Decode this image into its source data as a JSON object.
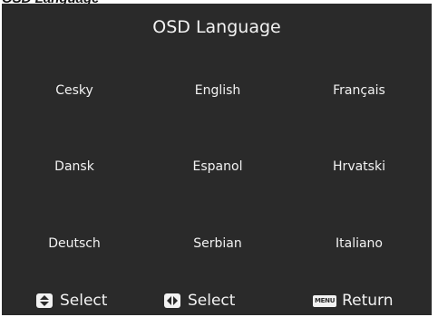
{
  "header_crop": "OSD Language",
  "osd": {
    "title": "OSD Language",
    "languages": [
      [
        "Cesky",
        "English",
        "Français"
      ],
      [
        "Dansk",
        "Espanol",
        "Hrvatski"
      ],
      [
        "Deutsch",
        "Serbian",
        "Italiano"
      ]
    ]
  },
  "footer": {
    "updown_label": "Select",
    "leftright_label": "Select",
    "menu_key_label": "MENU",
    "return_label": "Return"
  },
  "colors": {
    "background": "#2a2a2a",
    "text": "#f2f2f2"
  }
}
